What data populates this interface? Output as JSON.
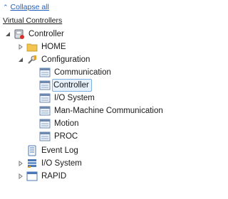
{
  "toolbar": {
    "collapse_all": "Collapse all"
  },
  "section_title": "Virtual Controllers",
  "tree": {
    "controller": "Controller",
    "home": "HOME",
    "configuration": "Configuration",
    "config_items": [
      "Communication",
      "Controller",
      "I/O System",
      "Man-Machine Communication",
      "Motion",
      "PROC"
    ],
    "selected_item": "Controller",
    "event_log": "Event Log",
    "io_system": "I/O System",
    "rapid": "RAPID"
  },
  "colors": {
    "link": "#1f5fbf",
    "selection_border": "#7ab2e2",
    "selection_fill": "#e6f1fb",
    "folder": "#f3c44f"
  }
}
